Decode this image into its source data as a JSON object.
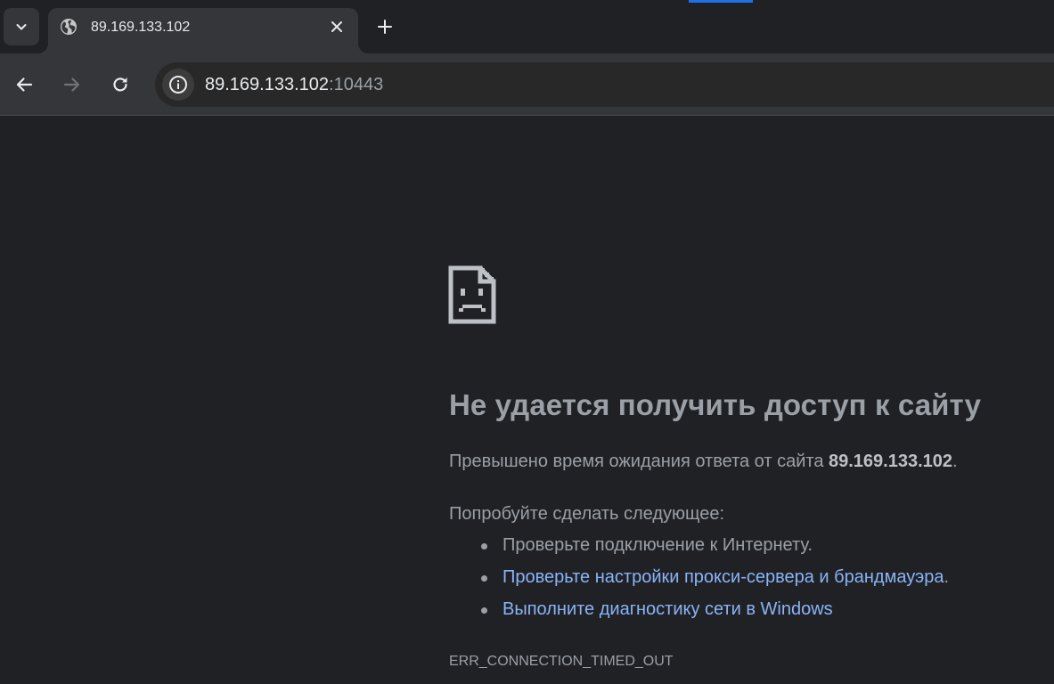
{
  "colors": {
    "page_background": "#202124",
    "toolbar_background": "#35363a",
    "text_muted": "#9aa0a6",
    "link": "#8ab4f8",
    "accent": "#1a73e8"
  },
  "tabstrip": {
    "tab_search_icon": "chevron-down-icon",
    "tabs": [
      {
        "title": "89.169.133.102",
        "favicon": "globe-icon",
        "close_icon": "close-icon"
      }
    ],
    "new_tab_icon": "plus-icon"
  },
  "toolbar": {
    "back_icon": "arrow-left-icon",
    "forward_icon": "arrow-right-icon",
    "reload_icon": "reload-icon",
    "site_info_icon": "info-icon",
    "url_host": "89.169.133.102",
    "url_port": ":10443"
  },
  "error_page": {
    "icon": "sad-page-icon",
    "title": "Не удается получить доступ к сайту",
    "description_prefix": "Превышено время ожидания ответа от сайта ",
    "description_host": "89.169.133.102",
    "description_suffix": ".",
    "suggestions_heading": "Попробуйте сделать следующее:",
    "suggestions": [
      {
        "text": "Проверьте подключение к Интернету.",
        "is_link": false
      },
      {
        "text": "Проверьте настройки прокси-сервера и брандмауэра",
        "is_link": true,
        "suffix": "."
      },
      {
        "text": "Выполните диагностику сети в Windows",
        "is_link": true,
        "suffix": ""
      }
    ],
    "error_code": "ERR_CONNECTION_TIMED_OUT"
  }
}
